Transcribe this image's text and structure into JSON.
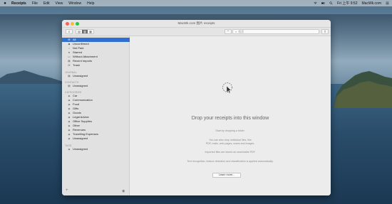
{
  "menubar": {
    "app_name": "Receipts",
    "menus": [
      "File",
      "Edit",
      "View",
      "Window",
      "Help"
    ],
    "clock": "Fri 上午 9:52",
    "user": "MacWk.com"
  },
  "window": {
    "title": "MacWk.com 图片 receipts",
    "search_placeholder": "搜索",
    "segments": [
      "▤",
      "▥",
      "▦"
    ],
    "filter_icon": "≡",
    "share_icon": "⇪"
  },
  "sidebar": {
    "items": [
      {
        "label": "All",
        "icon": "⊞"
      },
      {
        "label": "Unconfirmed",
        "icon": "◆"
      },
      {
        "label": "Not Paid",
        "icon": "○"
      },
      {
        "label": "Starred",
        "icon": "★"
      },
      {
        "label": "Without Attachment",
        "icon": "▭"
      },
      {
        "label": "Recent Imports",
        "icon": "▤"
      },
      {
        "label": "Trash",
        "icon": "⊟"
      }
    ],
    "journal_header": "JOURNAL",
    "journal_items": [
      {
        "label": "Unassigned",
        "icon": "▤"
      }
    ],
    "contacts_header": "CONTACTS",
    "contacts_items": [
      {
        "label": "Unassigned",
        "icon": "▤"
      }
    ],
    "categories_header": "CATEGORIES",
    "category_items": [
      {
        "label": "Car",
        "icon": "◈"
      },
      {
        "label": "Communication",
        "icon": "◈"
      },
      {
        "label": "Food",
        "icon": "◈"
      },
      {
        "label": "Gifts",
        "icon": "◈"
      },
      {
        "label": "Goods",
        "icon": "◈"
      },
      {
        "label": "Legal Advice",
        "icon": "◈"
      },
      {
        "label": "Office Supplies",
        "icon": "◈"
      },
      {
        "label": "Other",
        "icon": "◈"
      },
      {
        "label": "Revenues",
        "icon": "◈"
      },
      {
        "label": "Travelling Expenses",
        "icon": "◈"
      },
      {
        "label": "Unassigned",
        "icon": "◈"
      }
    ],
    "tags_header": "TAGS",
    "tags_items": [
      {
        "label": "Unassigned",
        "icon": "◈"
      }
    ],
    "add_icon": "+",
    "eye_icon": "◉"
  },
  "main": {
    "title": "Drop your receipts into this window",
    "lines": [
      "Start by dropping a folder.",
      "You can also drop individual files, like",
      "PDF, mails, web pages, scans and images.",
      "Imported files are stored as searchable PDF.",
      "Text recognition, feature detection and classification is applied automatically."
    ],
    "learn_more": "Learn more..."
  },
  "colors": {
    "selection": "#2f6fcf",
    "close": "#fc5f57",
    "minimize": "#fdbc2e",
    "maximize": "#27c840"
  }
}
